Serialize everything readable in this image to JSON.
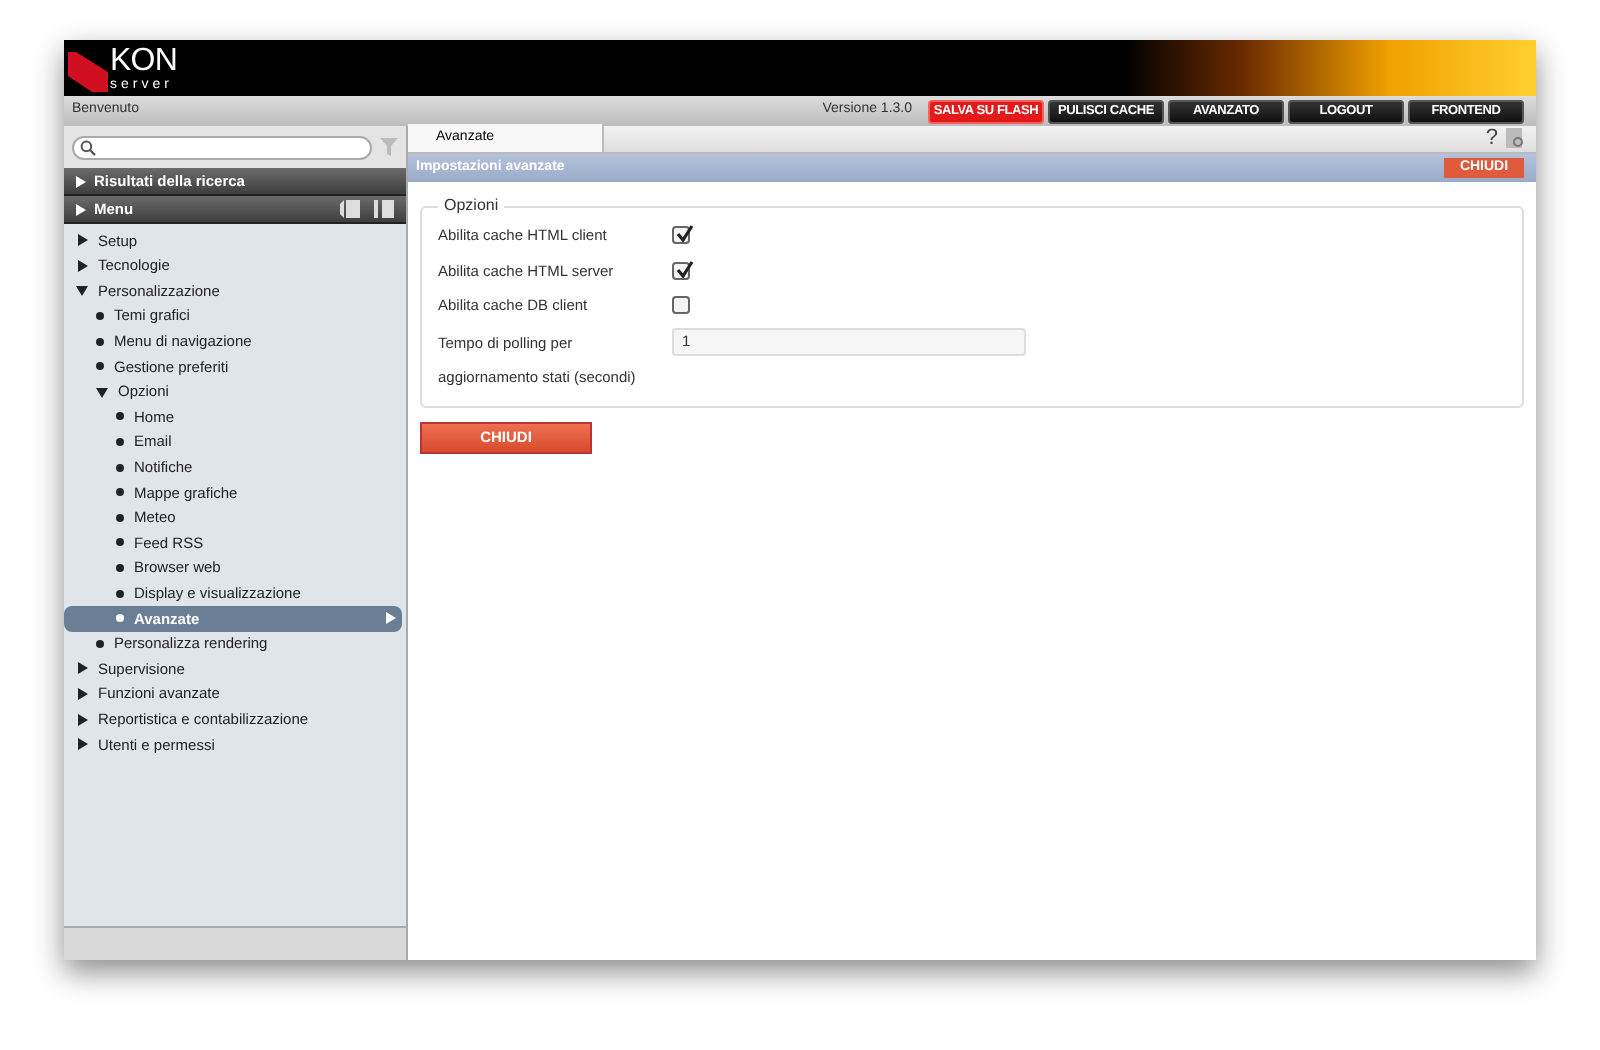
{
  "logo": {
    "wordmark": "KON",
    "subtitle": "server"
  },
  "topbar": {
    "welcome": "Benvenuto",
    "version": "Versione 1.3.0",
    "buttons": [
      {
        "label": "SALVA SU FLASH",
        "kind": "alert"
      },
      {
        "label": "PULISCI CACHE",
        "kind": "normal"
      },
      {
        "label": "AVANZATO",
        "kind": "normal"
      },
      {
        "label": "LOGOUT",
        "kind": "normal"
      },
      {
        "label": "FRONTEND",
        "kind": "normal"
      }
    ]
  },
  "sidebar": {
    "sections": [
      {
        "label": "Risultati della ricerca"
      },
      {
        "label": "Menu"
      }
    ],
    "tree": [
      {
        "label": "Setup",
        "expanded": false,
        "selected": false
      },
      {
        "label": "Tecnologie",
        "expanded": false,
        "selected": false
      },
      {
        "label": "Personalizzazione",
        "expanded": true,
        "selected": false,
        "children": [
          {
            "label": "Temi grafici",
            "selected": false
          },
          {
            "label": "Menu di navigazione",
            "selected": false
          },
          {
            "label": "Gestione preferiti",
            "selected": false
          },
          {
            "label": "Opzioni",
            "expanded": true,
            "selected": false,
            "children": [
              {
                "label": "Home",
                "selected": false
              },
              {
                "label": "Email",
                "selected": false
              },
              {
                "label": "Notifiche",
                "selected": false
              },
              {
                "label": "Mappe grafiche",
                "selected": false
              },
              {
                "label": "Meteo",
                "selected": false
              },
              {
                "label": "Feed RSS",
                "selected": false
              },
              {
                "label": "Browser web",
                "selected": false
              },
              {
                "label": "Display e visualizzazione",
                "selected": false
              },
              {
                "label": "Avanzate",
                "selected": true
              }
            ]
          },
          {
            "label": "Personalizza rendering",
            "selected": false
          }
        ]
      },
      {
        "label": "Supervisione",
        "expanded": false,
        "selected": false
      },
      {
        "label": "Funzioni avanzate",
        "expanded": false,
        "selected": false
      },
      {
        "label": "Reportistica e contabilizzazione",
        "expanded": false,
        "selected": false
      },
      {
        "label": "Utenti e permessi",
        "expanded": false,
        "selected": false
      }
    ]
  },
  "tabs": [
    {
      "label": "Avanzate",
      "selected": true
    }
  ],
  "help": "?",
  "panel": {
    "title": "Impostazioni avanzate",
    "close_button": "CHIUDI",
    "group": {
      "legend": "Opzioni",
      "options": [
        {
          "kind": "checkbox",
          "label": "Abilita cache HTML client",
          "checked": true
        },
        {
          "kind": "checkbox",
          "label": "Abilita cache HTML server",
          "checked": true
        },
        {
          "kind": "checkbox",
          "label": "Abilita cache DB client",
          "checked": false
        },
        {
          "kind": "text",
          "label": "Tempo di polling per aggiornamento stati (secondi)",
          "value": "1"
        }
      ]
    },
    "footer_button": "CHIUDI"
  }
}
